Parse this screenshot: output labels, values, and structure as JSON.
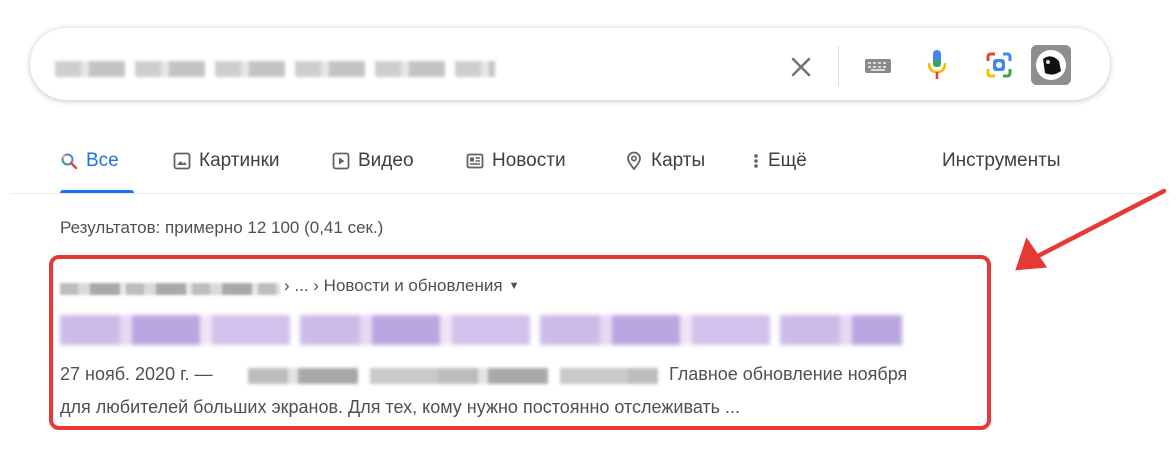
{
  "search": {
    "query_blurred": true
  },
  "icons": {
    "clear": "close-icon",
    "keyboard": "keyboard-icon",
    "mic": "microphone-icon",
    "lens": "camera-lens-icon",
    "avatar": "user-avatar"
  },
  "tabs": [
    {
      "label": "Все",
      "icon": "search-icon",
      "active": true
    },
    {
      "label": "Картинки",
      "icon": "image-icon"
    },
    {
      "label": "Видео",
      "icon": "video-icon"
    },
    {
      "label": "Новости",
      "icon": "news-icon"
    },
    {
      "label": "Карты",
      "icon": "map-pin-icon"
    },
    {
      "label": "Ещё",
      "icon": "more-vert-icon"
    }
  ],
  "tools_label": "Инструменты",
  "stats": "Результатов: примерно 12 100 (0,41 сек.)",
  "result": {
    "breadcrumb": "› ... › Новости и обновления",
    "date_prefix": "27 нояб. 2020 г. —",
    "snippet_after_blur": "Главное обновление ноября",
    "snippet_line2": "для любителей больших экранов. Для тех, кому нужно постоянно отслеживать ..."
  },
  "colors": {
    "accent": "#1a73e8",
    "highlight": "#e53935"
  }
}
